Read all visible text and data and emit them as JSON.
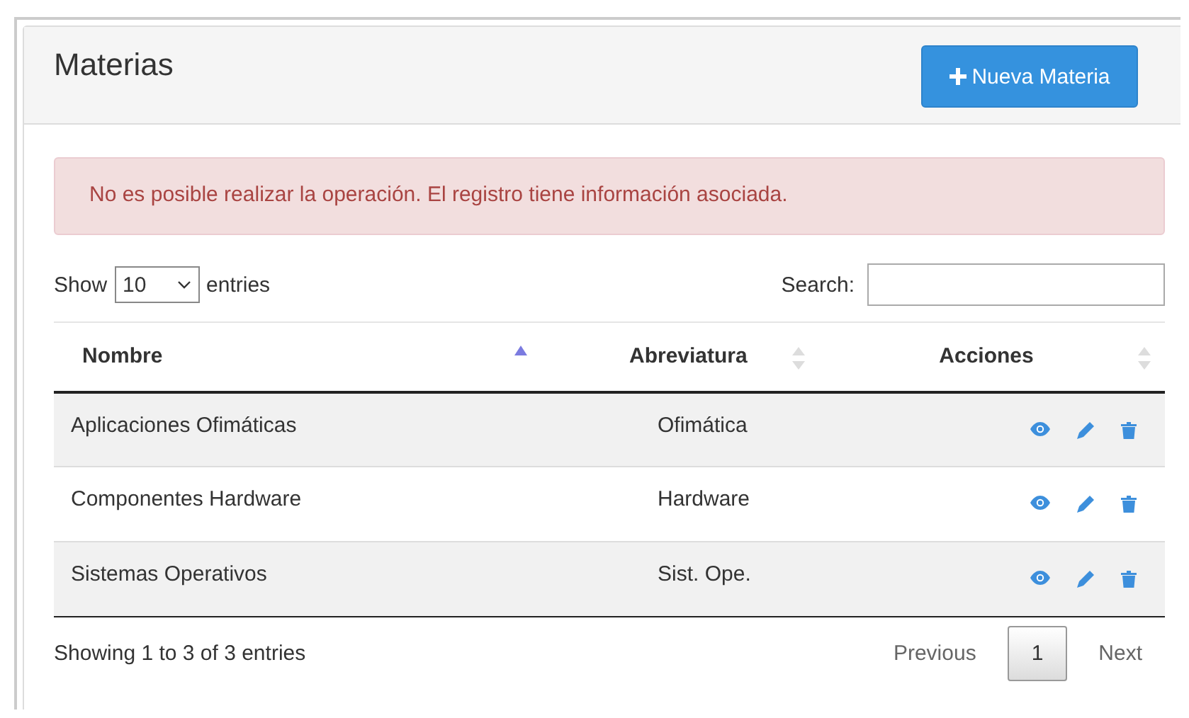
{
  "panel": {
    "title": "Materias",
    "new_button": "Nueva Materia"
  },
  "alert": {
    "message": "No es posible realizar la operación. El registro tiene información asociada."
  },
  "length_control": {
    "before": "Show",
    "value": "10",
    "after": "entries"
  },
  "search": {
    "label": "Search:"
  },
  "table": {
    "columns": [
      {
        "label": "Nombre",
        "sorted": true
      },
      {
        "label": "Abreviatura",
        "sorted": false
      },
      {
        "label": "Acciones",
        "sorted": false
      }
    ],
    "rows": [
      {
        "nombre": "Aplicaciones Ofimáticas",
        "abreviatura": "Ofimática"
      },
      {
        "nombre": "Componentes Hardware",
        "abreviatura": "Hardware"
      },
      {
        "nombre": "Sistemas Operativos",
        "abreviatura": "Sist. Ope."
      }
    ]
  },
  "info": "Showing 1 to 3 of 3 entries",
  "pagination": {
    "previous": "Previous",
    "pages": [
      {
        "label": "1",
        "selected": true
      }
    ],
    "next": "Next"
  }
}
